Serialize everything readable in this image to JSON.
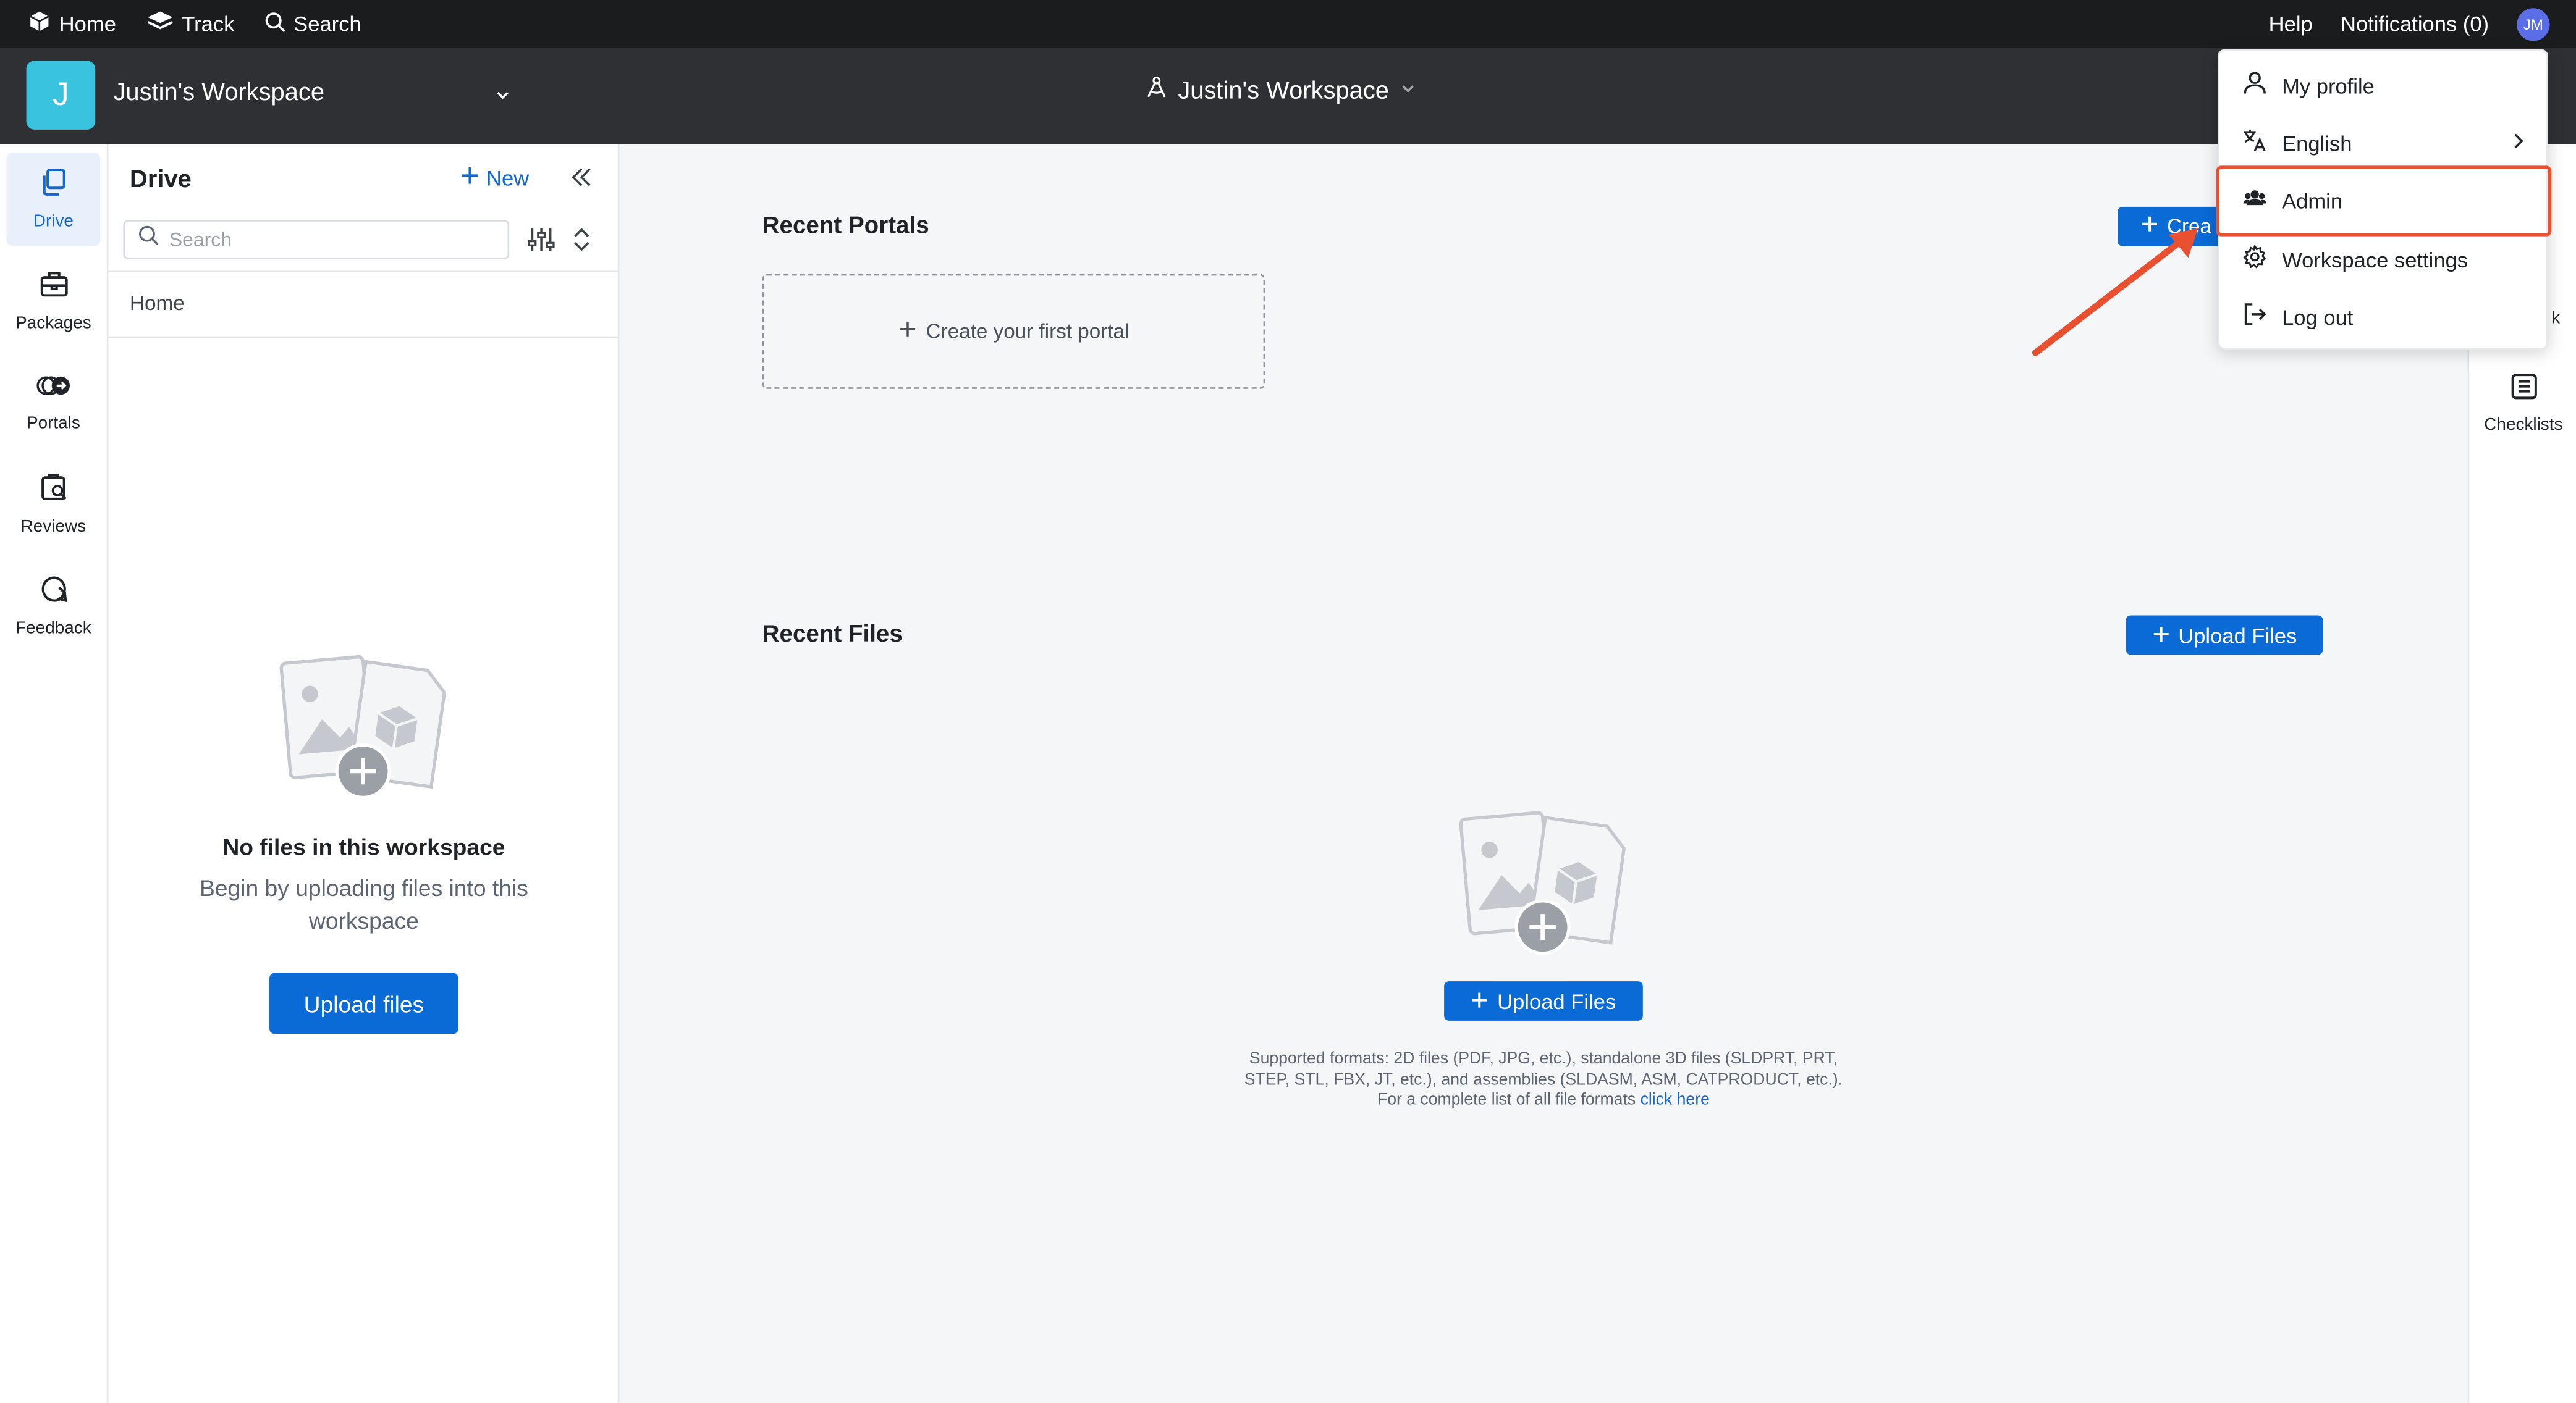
{
  "topbar": {
    "home": "Home",
    "track": "Track",
    "search": "Search",
    "help": "Help",
    "notifications": "Notifications (0)",
    "avatar_initials": "JM"
  },
  "workspace": {
    "logo_letter": "J",
    "name": "Justin's Workspace",
    "center_name": "Justin's Workspace"
  },
  "rail": {
    "items": [
      {
        "label": "Drive",
        "icon": "drive-icon"
      },
      {
        "label": "Packages",
        "icon": "packages-icon"
      },
      {
        "label": "Portals",
        "icon": "portals-icon"
      },
      {
        "label": "Reviews",
        "icon": "reviews-icon"
      },
      {
        "label": "Feedback",
        "icon": "feedback-icon"
      }
    ]
  },
  "drive": {
    "title": "Drive",
    "new_label": "New",
    "search_placeholder": "Search",
    "home_label": "Home",
    "empty_title": "No files in this workspace",
    "empty_subtitle": "Begin by uploading files into this workspace",
    "upload_label": "Upload files"
  },
  "main": {
    "recent_portals_title": "Recent Portals",
    "create_portal_label": "Crea",
    "portal_placeholder": "Create your first portal",
    "recent_files_title": "Recent Files",
    "upload_files_label": "Upload Files",
    "upload_files_center_label": "Upload Files",
    "formats_text": "Supported formats: 2D files (PDF, JPG, etc.), standalone 3D files (SLDPRT, PRT, STEP, STL, FBX, JT, etc.), and assemblies (SLDASM, ASM, CATPRODUCT, etc.). For a complete list of all file formats",
    "formats_link": "click here"
  },
  "right_rail": {
    "partial_label": "k",
    "checklists_label": "Checklists"
  },
  "menu": {
    "items": [
      {
        "label": "My profile",
        "icon": "user-icon"
      },
      {
        "label": "English",
        "icon": "language-icon"
      },
      {
        "label": "Admin",
        "icon": "admin-icon"
      },
      {
        "label": "Workspace settings",
        "icon": "gear-icon"
      },
      {
        "label": "Log out",
        "icon": "logout-icon"
      }
    ]
  },
  "colors": {
    "primary": "#0a6ad6",
    "highlight": "#e8502f",
    "topbar": "#1b1c1e",
    "workspace_bar": "#2f3033",
    "logo": "#3ac3de"
  }
}
